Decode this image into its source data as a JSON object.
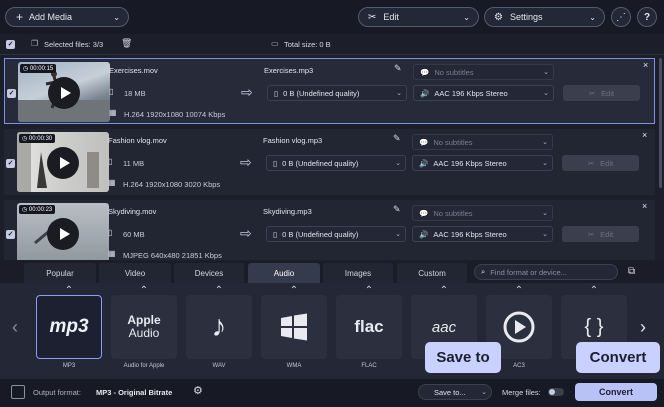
{
  "toolbar": {
    "add_media": "Add Media",
    "edit": "Edit",
    "settings": "Settings",
    "add_icon": "plus-icon",
    "share_icon": "share-icon",
    "help": "?"
  },
  "selection": {
    "selected_files": "Selected files: 3/3",
    "total_size": "Total size: 0 B"
  },
  "files": [
    {
      "duration": "00:00:15",
      "name": "Exercises.mov",
      "size": "18 MB",
      "codec": "H.264 1920x1080 10074 Kbps",
      "output_name": "Exercises.mp3",
      "output_size": "0 B (Undefined quality)",
      "subtitles": "No subtitles",
      "audio": "AAC 196 Kbps Stereo",
      "edit": "Edit"
    },
    {
      "duration": "00:00:30",
      "name": "Fashion vlog.mov",
      "size": "11 MB",
      "codec": "H.264 1920x1080 3020 Kbps",
      "output_name": "Fashion vlog.mp3",
      "output_size": "0 B (Undefined quality)",
      "subtitles": "No subtitles",
      "audio": "AAC 196 Kbps Stereo",
      "edit": "Edit"
    },
    {
      "duration": "00:00:23",
      "name": "Skydiving.mov",
      "size": "60 MB",
      "codec": "MJPEG 640x480 21851 Kbps",
      "output_name": "Skydiving.mp3",
      "output_size": "0 B (Undefined quality)",
      "subtitles": "No subtitles",
      "audio": "AAC 196 Kbps Stereo",
      "edit": "Edit"
    }
  ],
  "tabs": [
    "Popular",
    "Video",
    "Devices",
    "Audio",
    "Images",
    "Custom"
  ],
  "search": {
    "placeholder": "Find format or device..."
  },
  "formats": [
    {
      "label": "MP3",
      "icon_text": "mp3"
    },
    {
      "label": "Audio for Apple",
      "icon_text": "Apple",
      "icon_text2": "Audio"
    },
    {
      "label": "WAV",
      "icon_text": "♪"
    },
    {
      "label": "WMA",
      "icon_text": ""
    },
    {
      "label": "FLAC",
      "icon_text": "flac"
    },
    {
      "label": "AAC",
      "icon_text": "aac"
    },
    {
      "label": "AC3",
      "icon_text": ""
    },
    {
      "label": "",
      "icon_text": "{ }"
    }
  ],
  "bottom": {
    "output_format_label": "Output format:",
    "output_format_value": "MP3 - Original Bitrate",
    "save_to": "Save to...",
    "merge_files": "Merge files:",
    "convert": "Convert"
  },
  "tooltips": {
    "save_to": "Save to",
    "convert": "Convert"
  },
  "colors": {
    "accent": "#b9c2f7",
    "selection_border": "#7f90e6",
    "background": "#1c1f2a"
  }
}
